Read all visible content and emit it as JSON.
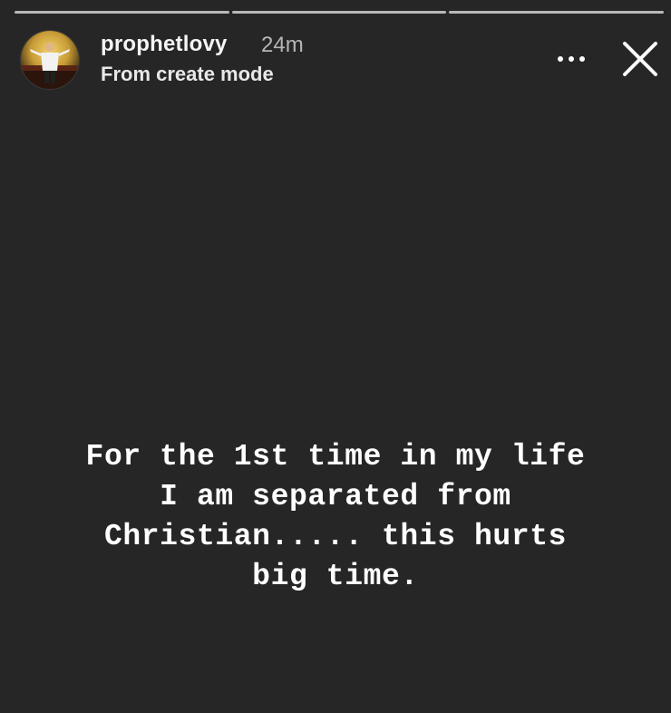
{
  "story": {
    "username": "prophetlovy",
    "time_ago": "24m",
    "subtitle": "From create mode",
    "text_lines": [
      "For the 1st time in my life",
      "I am separated from",
      "Christian..... this hurts",
      "big time."
    ]
  },
  "progress": {
    "segment_count": 3,
    "active_segment": 3
  },
  "icons": {
    "more": "more-options-icon",
    "close": "close-icon"
  },
  "colors": {
    "background": "#262626",
    "text": "#ffffff",
    "timestamp": "#b5b5b5"
  }
}
